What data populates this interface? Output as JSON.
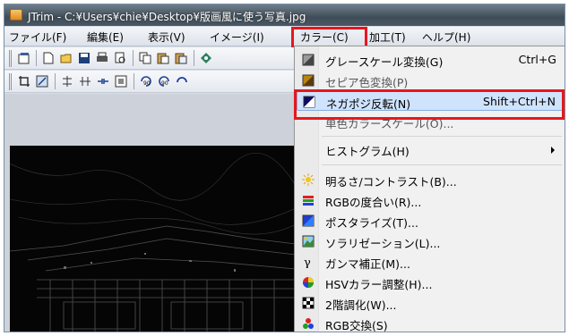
{
  "window": {
    "title": "JTrim - C:¥Users¥chie¥Desktop¥版画風に使う写真.jpg"
  },
  "menubar": {
    "items": [
      {
        "label": "ファイル(F)"
      },
      {
        "label": "編集(E)"
      },
      {
        "label": "表示(V)"
      },
      {
        "label": "イメージ(I)"
      },
      {
        "label": "カラー(C)"
      },
      {
        "label": "加工(T)"
      },
      {
        "label": "ヘルプ(H)"
      }
    ],
    "active": "カラー(C)"
  },
  "toolbar1": {
    "icons": [
      "new-window-icon",
      "new-file-icon",
      "open-folder-icon",
      "save-icon",
      "print-icon",
      "print-preview-icon",
      "copy-icon",
      "paste-icon",
      "paste-new-icon",
      "capture-icon"
    ]
  },
  "toolbar2": {
    "icons": [
      "crop-icon",
      "resize-icon",
      "flip-vertical-icon",
      "flip-horizontal-icon",
      "shrink-icon",
      "frame-icon",
      "rotate-90-icon",
      "rotate-270-icon",
      "rotate-free-icon"
    ],
    "rotate_90_label": "90",
    "rotate_270_label": "90"
  },
  "color_menu": {
    "items": [
      {
        "label": "グレースケール変換(G)",
        "shortcut": "Ctrl+G",
        "icon": "grayscale-icon"
      },
      {
        "label": "セピア色変換(P)",
        "shortcut": "",
        "icon": "sepia-icon"
      },
      {
        "label": "ネガポジ反転(N)",
        "shortcut": "Shift+Ctrl+N",
        "icon": "negative-icon",
        "highlighted": true
      },
      {
        "label": "単色カラースケール(O)...",
        "shortcut": "",
        "icon": ""
      },
      {
        "label": "ヒストグラム(H)",
        "shortcut": "",
        "icon": "",
        "submenu": true
      },
      {
        "label": "明るさ/コントラスト(B)...",
        "shortcut": "",
        "icon": "brightness-icon"
      },
      {
        "label": "RGBの度合い(R)...",
        "shortcut": "",
        "icon": "rgb-level-icon"
      },
      {
        "label": "ポスタライズ(T)...",
        "shortcut": "",
        "icon": "posterize-icon"
      },
      {
        "label": "ソラリゼーション(L)...",
        "shortcut": "",
        "icon": "solarize-icon"
      },
      {
        "label": "ガンマ補正(M)...",
        "shortcut": "",
        "icon": "gamma-icon"
      },
      {
        "label": "HSVカラー調整(H)...",
        "shortcut": "",
        "icon": "hsv-icon"
      },
      {
        "label": "2階調化(W)...",
        "shortcut": "",
        "icon": "two-tone-icon"
      },
      {
        "label": "RGB交換(S)",
        "shortcut": "",
        "icon": "rgb-swap-icon"
      }
    ]
  },
  "colors": {
    "highlight_border": "#e8161c",
    "menu_highlight": "#cfe3fd",
    "titlebar": "#3f4d58",
    "image_background": "#060606"
  }
}
